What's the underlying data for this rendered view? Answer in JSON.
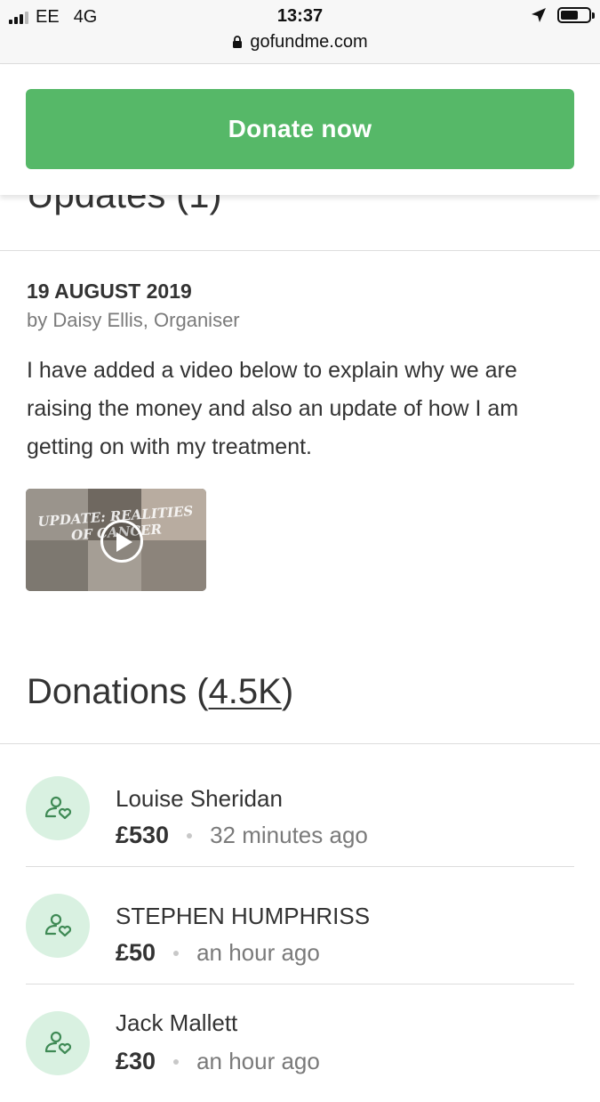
{
  "status_bar": {
    "carrier": "EE",
    "network": "4G",
    "time": "13:37",
    "url": "gofundme.com",
    "icons": [
      "signal-icon",
      "lock-icon",
      "location-arrow-icon",
      "battery-icon"
    ]
  },
  "donate_button": {
    "label": "Donate now",
    "color": "#56b868"
  },
  "updates": {
    "title": "Updates (1)",
    "post": {
      "date": "19 AUGUST 2019",
      "author": "by Daisy Ellis, Organiser",
      "body": "I have added a video below to explain why we are raising the money and also an update of how I am getting on with my treatment.",
      "video_caption": "UPDATE: REALITIES OF CANCER"
    }
  },
  "donations": {
    "title_prefix": "Donations (",
    "count": "4.5K",
    "title_suffix": ")",
    "avatar_icon": "person-heart-icon",
    "avatar_bg": "#d9f1e1",
    "items": [
      {
        "name": "Louise Sheridan",
        "amount": "£530",
        "time": "32 minutes ago"
      },
      {
        "name": "STEPHEN HUMPHRISS",
        "amount": "£50",
        "time": "an hour ago"
      },
      {
        "name": "Jack Mallett",
        "amount": "£30",
        "time": "an hour ago"
      }
    ]
  }
}
